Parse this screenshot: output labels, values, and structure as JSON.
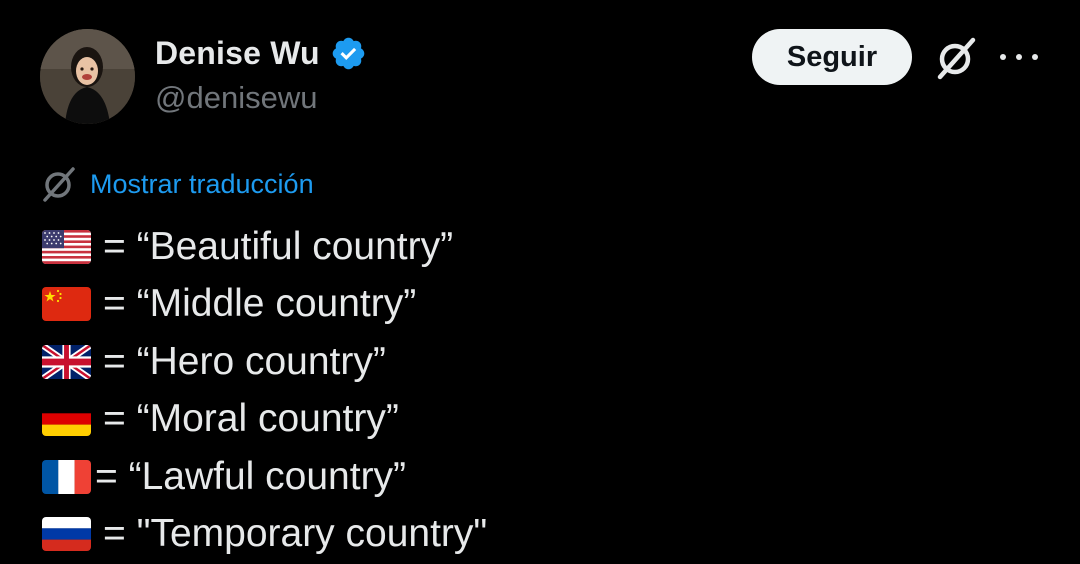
{
  "tweet": {
    "author": {
      "name": "Denise Wu",
      "handle": "@denisewu",
      "verified": true,
      "verified_color": "#1d9bf0"
    },
    "actions": {
      "follow_label": "Seguir",
      "grok_icon": "grok-icon",
      "more_icon": "more-options-icon"
    },
    "translate_label": "Mostrar traducción",
    "lines": [
      {
        "flag": "us-flag-icon",
        "text": "= “Beautiful country”"
      },
      {
        "flag": "china-flag-icon",
        "text": "= “Middle country”"
      },
      {
        "flag": "uk-flag-icon",
        "text": "= “Hero country”"
      },
      {
        "flag": "germany-flag-icon",
        "text": "= “Moral country”"
      },
      {
        "flag": "france-flag-icon",
        "text": "= “Lawful country”"
      },
      {
        "flag": "russia-flag-icon",
        "text": "= \"Temporary country\""
      }
    ]
  },
  "colors": {
    "background": "#000000",
    "text_primary": "#e7e9ea",
    "text_secondary": "#71767b",
    "link": "#1d9bf0",
    "button_bg": "#eff3f4"
  }
}
